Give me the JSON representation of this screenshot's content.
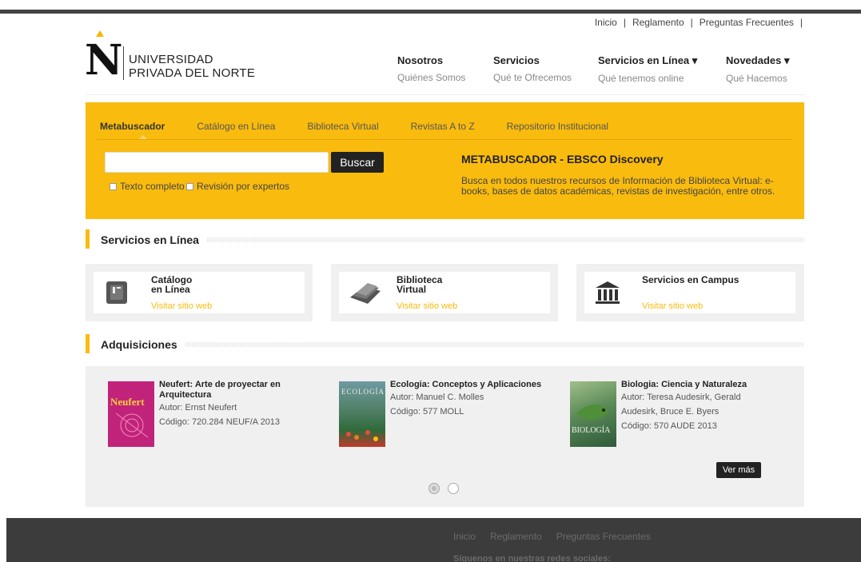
{
  "toplinks": {
    "inicio": "Inicio",
    "reglamento": "Reglamento",
    "preguntas": "Preguntas Frecuentes",
    "sep": "|"
  },
  "logo": {
    "line1": "UNIVERSIDAD",
    "line2": "PRIVADA DEL NORTE",
    "mark": "N"
  },
  "nav": [
    {
      "title": "Nosotros",
      "sub": "Quiénes Somos"
    },
    {
      "title": "Servicios",
      "sub": "Qué te Ofrecemos"
    },
    {
      "title": "Servicios en Línea ▾",
      "sub": "Qué tenemos online"
    },
    {
      "title": "Novedades ▾",
      "sub": "Qué Hacemos"
    }
  ],
  "search": {
    "tabs": [
      "Metabuscador",
      "Catálogo en Línea",
      "Biblioteca Virtual",
      "Revistas A to Z",
      "Repositorio Institucional"
    ],
    "button": "Buscar",
    "input_value": "",
    "check1": "Texto completo",
    "check2": "Revisión por expertos",
    "title": "METABUSCADOR - EBSCO Discovery",
    "desc": "Busca en todos nuestros recursos de Información de Biblioteca Virtual: e-books, bases de datos académicas, revistas de investigación, entre otros."
  },
  "services": {
    "heading": "Servicios en Línea",
    "items": [
      {
        "title_l1": "Catálogo",
        "title_l2": "en Línea",
        "link": "Visitar sitio web",
        "icon": "catalog-icon"
      },
      {
        "title_l1": "Biblioteca",
        "title_l2": "Virtual",
        "link": "Visitar sitio web",
        "icon": "books-icon"
      },
      {
        "title_l1": "Servicios en Campus",
        "title_l2": "",
        "link": "Visitar sitio web",
        "icon": "building-icon"
      }
    ]
  },
  "acquisitions": {
    "heading": "Adquisiciones",
    "button": "Ver más",
    "books": [
      {
        "title_l1": "Neufert: Arte de proyectar en",
        "title_l2": "Arquitectura",
        "lines": [
          "Autor: Ernst Neufert",
          "Código: 720.284 NEUF/A 2013"
        ],
        "cover_text": "Neufert",
        "cover_color": "#c2237a"
      },
      {
        "title_l1": "Ecologia: Conceptos y Aplicaciones",
        "title_l2": "",
        "lines": [
          "Autor: Manuel C. Molles",
          "Código: 577 MOLL"
        ],
        "cover_text": "ECOLOGÍA",
        "cover_color": "#3f7a4d"
      },
      {
        "title_l1": "Biologia: Ciencia y Naturaleza",
        "title_l2": "",
        "lines": [
          "Autor: Teresa Audesirk, Gerald",
          "Audesirk, Bruce E. Byers",
          "Código: 570 AUDE 2013"
        ],
        "cover_text": "BIOLOGÍA",
        "cover_color": "#5b8a58"
      }
    ]
  },
  "footer": {
    "links": [
      "Inicio",
      "Reglamento",
      "Preguntas Frecuentes"
    ],
    "social": "Síguenos en nuestras redes sociales:"
  },
  "colors": {
    "accent": "#f9bb0e",
    "dark": "#222222",
    "footer": "#3c3c3c"
  }
}
